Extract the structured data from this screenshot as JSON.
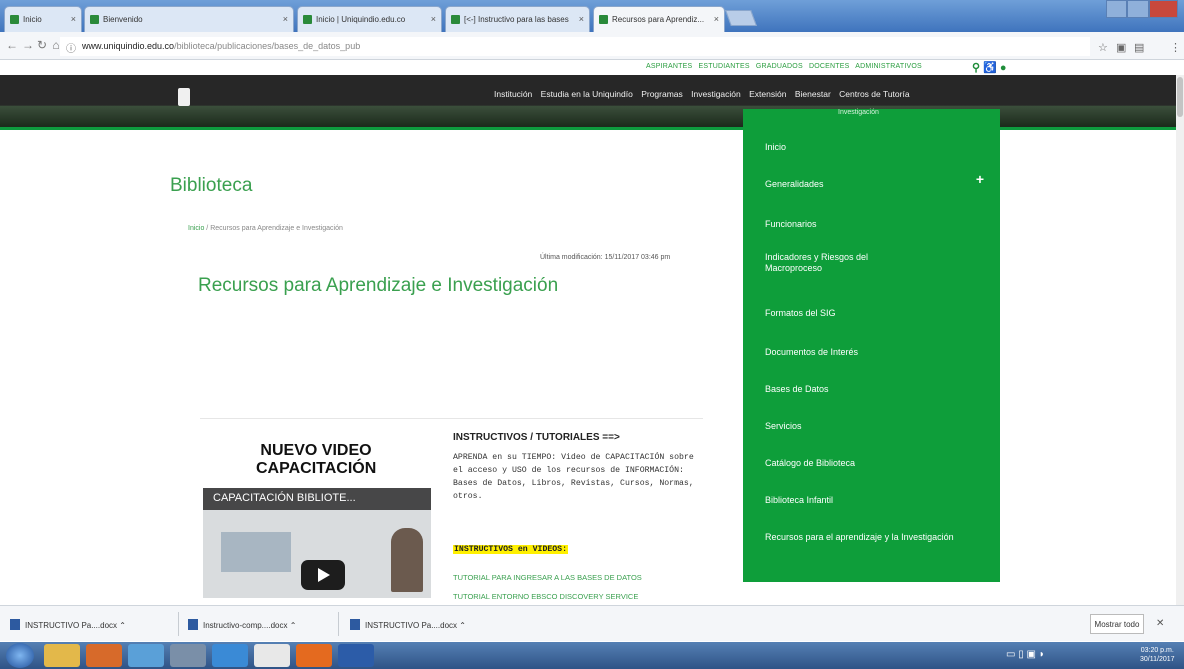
{
  "browser": {
    "tabs": [
      {
        "label": "Inicio"
      },
      {
        "label": "Bienvenido"
      },
      {
        "label": "Inicio | Uniquindio.edu.co"
      },
      {
        "label": "[<-] Instructivo para las bases"
      },
      {
        "label": "Recursos para Aprendiz..."
      }
    ],
    "url_host": "www.uniquindio.edu.co",
    "url_path": "/biblioteca/publicaciones/bases_de_datos_pub"
  },
  "site": {
    "util_links": [
      "ASPIRANTES",
      "ESTUDIANTES",
      "GRADUADOS",
      "DOCENTES",
      "ADMINISTRATIVOS"
    ],
    "nav": [
      "Institución",
      "Estudia en la Uniquindío",
      "Programas",
      "Investigación",
      "Extensión",
      "Bienestar",
      "Centros de Tutoría"
    ],
    "dropdown_top": "Investigación",
    "dropdown": [
      "Inicio",
      "Generalidades",
      "Funcionarios",
      "Indicadores y Riesgos del Macroproceso",
      "Formatos del SIG",
      "Documentos de Interés",
      "Bases de Datos",
      "Servicios",
      "Catálogo de Biblioteca",
      "Biblioteca Infantil",
      "Recursos para el aprendizaje y la Investigación"
    ],
    "dropdown_plus": "+"
  },
  "page": {
    "section_title": "Biblioteca",
    "breadcrumb_home": "Inicio",
    "breadcrumb_sep": "/",
    "breadcrumb_current": "Recursos para Aprendizaje e Investigación",
    "last_modified": "Última modificación: 15/11/2017 03:46 pm",
    "heading": "Recursos para Aprendizaje e Investigación",
    "video_heading": "NUEVO VIDEO CAPACITACIÓN",
    "video_bar_title": "CAPACITACIÓN BIBLIOTE...",
    "instr_heading": "INSTRUCTIVOS / TUTORIALES ==>",
    "instr_body": "APRENDA en su TIEMPO: Video de CAPACITACIÓN sobre el acceso y USO de los recursos de INFORMACIÓN: Bases de Datos, Libros, Revistas, Cursos, Normas, otros.",
    "instr_highlight": "INSTRUCTIVOS en VIDEOS:",
    "instr_link1": "TUTORIAL PARA INGRESAR A LAS BASES DE DATOS",
    "instr_link2": "TUTORIAL ENTORNO EBSCO DISCOVERY SERVICE"
  },
  "downloads": {
    "items": [
      "INSTRUCTIVO Pa....docx",
      "Instructivo-comp....docx",
      "INSTRUCTIVO Pa....docx"
    ],
    "show_all": "Mostrar todo",
    "close": "✕"
  },
  "taskbar": {
    "time": "03:20 p.m.",
    "date": "30/11/2017"
  }
}
